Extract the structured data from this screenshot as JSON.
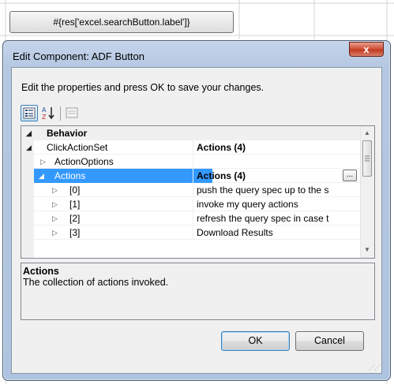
{
  "background": {
    "button_label": "#{res['excel.searchButton.label']}"
  },
  "dialog": {
    "title": "Edit Component: ADF Button",
    "close_glyph": "x",
    "instruction": "Edit the properties and press OK to save your changes.",
    "toolbar": {
      "categorized_icon": "categorized-icon",
      "alphabetical_icon": "alphabetical-sort-icon",
      "pages_icon": "property-pages-icon"
    },
    "grid": {
      "rows": [
        {
          "name": "Behavior",
          "value": "",
          "kind": "category",
          "expander": "◢"
        },
        {
          "name": "ClickActionSet",
          "value": "Actions (4)",
          "kind": "expanded",
          "expander": "◢",
          "bold_value": true
        },
        {
          "name": "ActionOptions",
          "value": "",
          "kind": "collapsed",
          "expander": "▷"
        },
        {
          "name": "Actions",
          "value": "Actions (4)",
          "kind": "selected",
          "expander": "◢",
          "bold_value": true,
          "ellipsis": "..."
        },
        {
          "name": "[0]",
          "value": "push the query spec up to the s",
          "kind": "collapsed",
          "expander": "▷"
        },
        {
          "name": "[1]",
          "value": "invoke my query actions",
          "kind": "collapsed",
          "expander": "▷"
        },
        {
          "name": "[2]",
          "value": "refresh the query spec in case t",
          "kind": "collapsed",
          "expander": "▷"
        },
        {
          "name": "[3]",
          "value": "Download Results",
          "kind": "collapsed",
          "expander": "▷"
        }
      ]
    },
    "help": {
      "title": "Actions",
      "description": "The collection of actions invoked."
    },
    "buttons": {
      "ok": "OK",
      "cancel": "Cancel"
    }
  }
}
